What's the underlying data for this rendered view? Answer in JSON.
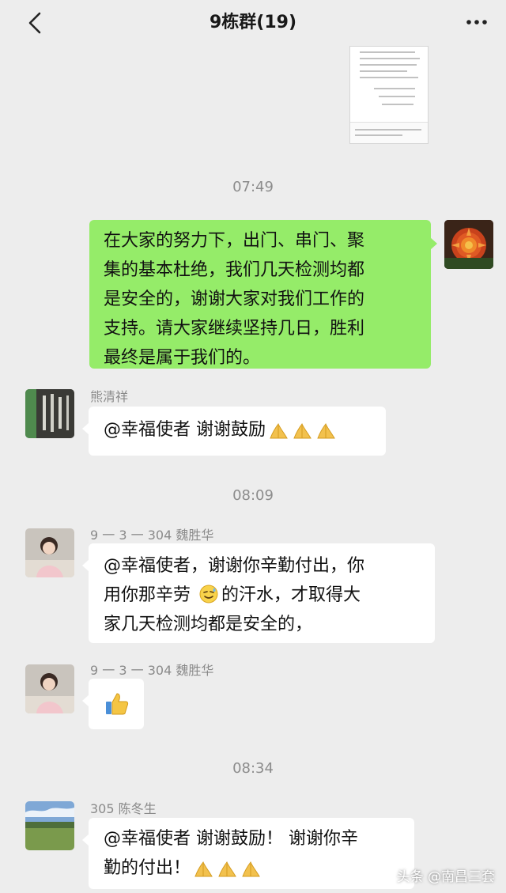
{
  "header": {
    "title": "9栋群(19)",
    "back_icon": "chevron-left-icon",
    "more_icon": "more-dots-icon"
  },
  "times": [
    "07:49",
    "08:09",
    "08:34"
  ],
  "messages": [
    {
      "side": "right",
      "text": "在大家的努力下，出门、串门、聚集的基本杜绝，我们几天检测均都是安全的，谢谢大家对我们工作的支持。请大家继续坚持几日，胜利最终是属于我们的。",
      "lines": [
        "在大家的努力下，出门、串门、聚",
        "集的基本杜绝，我们几天检测均都",
        "是安全的，谢谢大家对我们工作的",
        "支持。请大家继续坚持几日，胜利",
        "最终是属于我们的。"
      ]
    },
    {
      "side": "left",
      "sender": "熊清祥",
      "text": "@幸福使者 谢谢鼓励",
      "emoji": "praying-hands x3"
    },
    {
      "side": "left",
      "sender": "9 一 3 一 304 魏胜华",
      "lines": [
        "@幸福使者，谢谢你辛勤付出，你",
        "用你那辛劳",
        "的汗水，才取得大",
        "家几天检测均都是安全的，"
      ],
      "emoji": "sweat-smile"
    },
    {
      "side": "left",
      "sender": "9 一 3 一 304 魏胜华",
      "emoji": "thumbs-up"
    },
    {
      "side": "left",
      "sender": "305 陈冬生",
      "lines": [
        "@幸福使者 谢谢鼓励！ 谢谢你辛",
        "勤的付出！"
      ],
      "emoji": "praying-hands x3"
    }
  ],
  "watermark": "头条 @南昌三套",
  "colors": {
    "background": "#ededed",
    "self_bubble": "#95ec69",
    "other_bubble": "#ffffff",
    "time_text": "#8c8c8c"
  }
}
